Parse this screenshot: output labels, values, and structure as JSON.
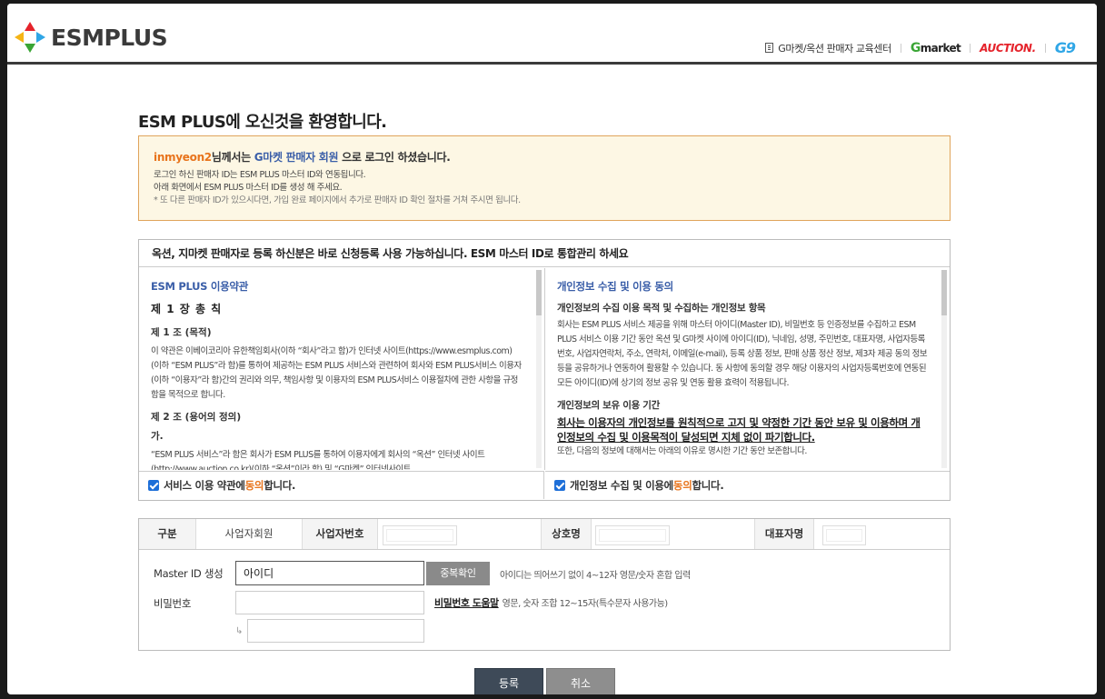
{
  "header": {
    "logo_text": "ESMPLUS",
    "nav": {
      "edu_center": "G마켓/옥션 판매자 교육센터",
      "gmarket_g": "G",
      "gmarket_rest": "market",
      "auction": "AUCTION.",
      "g9": "G9"
    }
  },
  "page_title": "ESM PLUS에 오신것을 환영합니다.",
  "notice": {
    "user_id": "inmyeon2",
    "head_mid": "님께서는 ",
    "member_type": "G마켓 판매자 회원",
    "head_tail": " 으로 로그인 하셨습니다.",
    "line1": "로그인 하신 판매자 ID는 ESM PLUS 마스터 ID와 연동됩니다.",
    "line2": "아래 화면에서 ESM PLUS 마스터 ID를 생성 해 주세요.",
    "line3": "* 또 다른 판매자 ID가 있으시다면, 가입 완료 페이지에서 추가로 판매자 ID 확인 절차를 거쳐 주시면 됩니다."
  },
  "terms": {
    "header": "옥션, 지마켓 판매자로 등록 하신분은 바로 신청등록 사용 가능하십니다. ESM 마스터 ID로 통합관리 하세요",
    "left": {
      "title": "ESM PLUS 이용약관",
      "chapter": "제 1 장   총 칙",
      "art1_title": "제 1 조 (목적)",
      "art1_text": "이 약관은 이베이코리아 유한책임회사(이하 “회사”라고 함)가 인터넷 사이트(https://www.esmplus.com)(이하 “ESM PLUS”라 함)를 통하여 제공하는 ESM PLUS 서비스와 관련하여 회사와 ESM PLUS서비스 이용자(이하 “이용자”라 함)간의 권리와 의무, 책임사항 및 이용자의 ESM PLUS서비스 이용절차에 관한 사항을 규정함을 목적으로 합니다.",
      "art2_title": "제 2 조 (용어의 정의)",
      "art2_sub": "가.",
      "art2_text": "“ESM PLUS 서비스”라 함은 회사가 ESM PLUS를 통하여 이용자에게 회사의 “옥션” 인터넷 사이트(http://www.auction.co.kr)(이하 “옥션”이라 함) 및 “G마켓” 인터넷사이트"
    },
    "right": {
      "title": "개인정보 수집 및 이용 동의",
      "sub1": "개인정보의 수집 이용 목적 및 수집하는 개인정보 항목",
      "text1": "회사는 ESM PLUS 서비스 제공을 위해 마스터 아이디(Master ID), 비밀번호 등 인증정보를 수집하고 ESM PLUS 서비스 이용 기간 동안 옥션 및 G마켓 사이에 아이디(ID), 닉네임, 성명, 주민번호, 대표자명, 사업자등록번호, 사업자연락처, 주소, 연락처, 이메일(e-mail), 등록 상품 정보, 판매 상품 정산 정보, 제3자 제공 동의 정보 등을 공유하거나 연동하여 활용할 수 있습니다. 동 사항에 동의할 경우 해당 이용자의 사업자등록번호에 연동된 모든 아이디(ID)에 상기의 정보 공유 및 연동 활용 효력이 적용됩니다.",
      "sub2": "개인정보의 보유 이용 기간",
      "strong": "회사는 이용자의 개인정보를 원칙적으로 고지 및 약정한 기간 동안 보유 및 이용하며 개인정보의 수집 및 이용목적이 달성되면 지체 없이 파기합니다.",
      "text2": "또한, 다음의 정보에 대해서는 아래의 이유로 명시한 기간 동안 보존합니다."
    },
    "agree_left_pre": "서비스 이용 약관에 ",
    "agree_right_pre": "개인정보 수집 및 이용에 ",
    "agree_word": "동의",
    "agree_post": " 합니다."
  },
  "form": {
    "type_label": "구분",
    "type_value": "사업자회원",
    "bizno_label": "사업자번호",
    "company_label": "상호명",
    "ceo_label": "대표자명",
    "master_id_label": "Master ID 생성",
    "master_id_value": "아이디",
    "dup_check": "중복확인",
    "id_hint": "아이디는 띄어쓰기 없이 4~12자 영문/숫자 혼합 입력",
    "password_label": "비밀번호",
    "pw_help": "비밀번호 도움말",
    "pw_hint": "영문, 숫자 조합 12~15자(특수문자 사용가능)",
    "arrow": "↳"
  },
  "buttons": {
    "register": "등록",
    "cancel": "취소"
  },
  "colors": {
    "accent_orange": "#e8741c",
    "accent_blue": "#3a5ea8",
    "notice_bg": "#fdf7e4",
    "notice_border": "#e0a45b"
  }
}
